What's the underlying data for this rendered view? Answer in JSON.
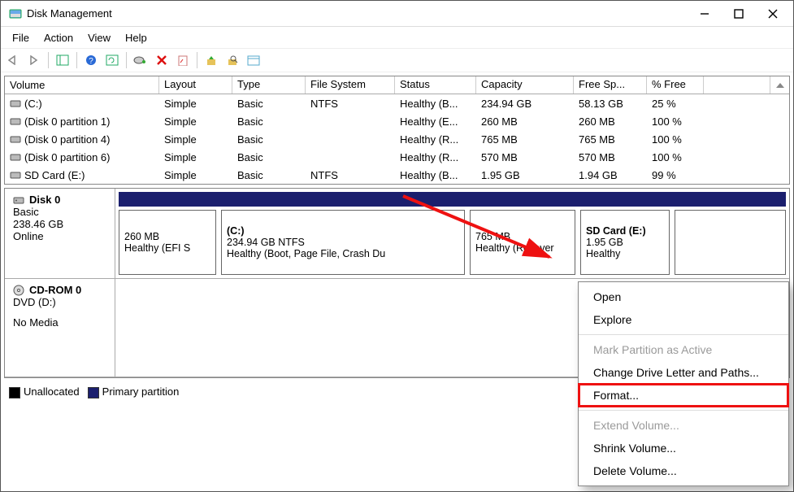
{
  "window": {
    "title": "Disk Management"
  },
  "menu": {
    "file": "File",
    "action": "Action",
    "view": "View",
    "help": "Help"
  },
  "columns": {
    "volume": "Volume",
    "layout": "Layout",
    "type": "Type",
    "fs": "File System",
    "status": "Status",
    "capacity": "Capacity",
    "free": "Free Sp...",
    "pct": "% Free"
  },
  "volumes": [
    {
      "name": "(C:)",
      "layout": "Simple",
      "type": "Basic",
      "fs": "NTFS",
      "status": "Healthy (B...",
      "cap": "234.94 GB",
      "free": "58.13 GB",
      "pct": "25 %"
    },
    {
      "name": "(Disk 0 partition 1)",
      "layout": "Simple",
      "type": "Basic",
      "fs": "",
      "status": "Healthy (E...",
      "cap": "260 MB",
      "free": "260 MB",
      "pct": "100 %"
    },
    {
      "name": "(Disk 0 partition 4)",
      "layout": "Simple",
      "type": "Basic",
      "fs": "",
      "status": "Healthy (R...",
      "cap": "765 MB",
      "free": "765 MB",
      "pct": "100 %"
    },
    {
      "name": "(Disk 0 partition 6)",
      "layout": "Simple",
      "type": "Basic",
      "fs": "",
      "status": "Healthy (R...",
      "cap": "570 MB",
      "free": "570 MB",
      "pct": "100 %"
    },
    {
      "name": "SD Card (E:)",
      "layout": "Simple",
      "type": "Basic",
      "fs": "NTFS",
      "status": "Healthy (B...",
      "cap": "1.95 GB",
      "free": "1.94 GB",
      "pct": "99 %"
    }
  ],
  "disk0": {
    "label": "Disk 0",
    "type": "Basic",
    "size": "238.46 GB",
    "state": "Online",
    "p1": {
      "title": "",
      "line2": "260 MB",
      "line3": "Healthy (EFI S"
    },
    "p2": {
      "title": "(C:)",
      "line2": "234.94 GB NTFS",
      "line3": "Healthy (Boot, Page File, Crash Du"
    },
    "p3": {
      "title": "",
      "line2": "765 MB",
      "line3": "Healthy (Recover"
    },
    "p4": {
      "title": "SD Card  (E:)",
      "line2": "1.95 GB",
      "line3": "Healthy"
    }
  },
  "cdrom": {
    "label": "CD-ROM 0",
    "line2": "DVD (D:)",
    "line3": "No Media"
  },
  "legend": {
    "unalloc": "Unallocated",
    "primary": "Primary partition"
  },
  "ctx": {
    "open": "Open",
    "explore": "Explore",
    "mark": "Mark Partition as Active",
    "change": "Change Drive Letter and Paths...",
    "format": "Format...",
    "extend": "Extend Volume...",
    "shrink": "Shrink Volume...",
    "delete": "Delete Volume..."
  }
}
